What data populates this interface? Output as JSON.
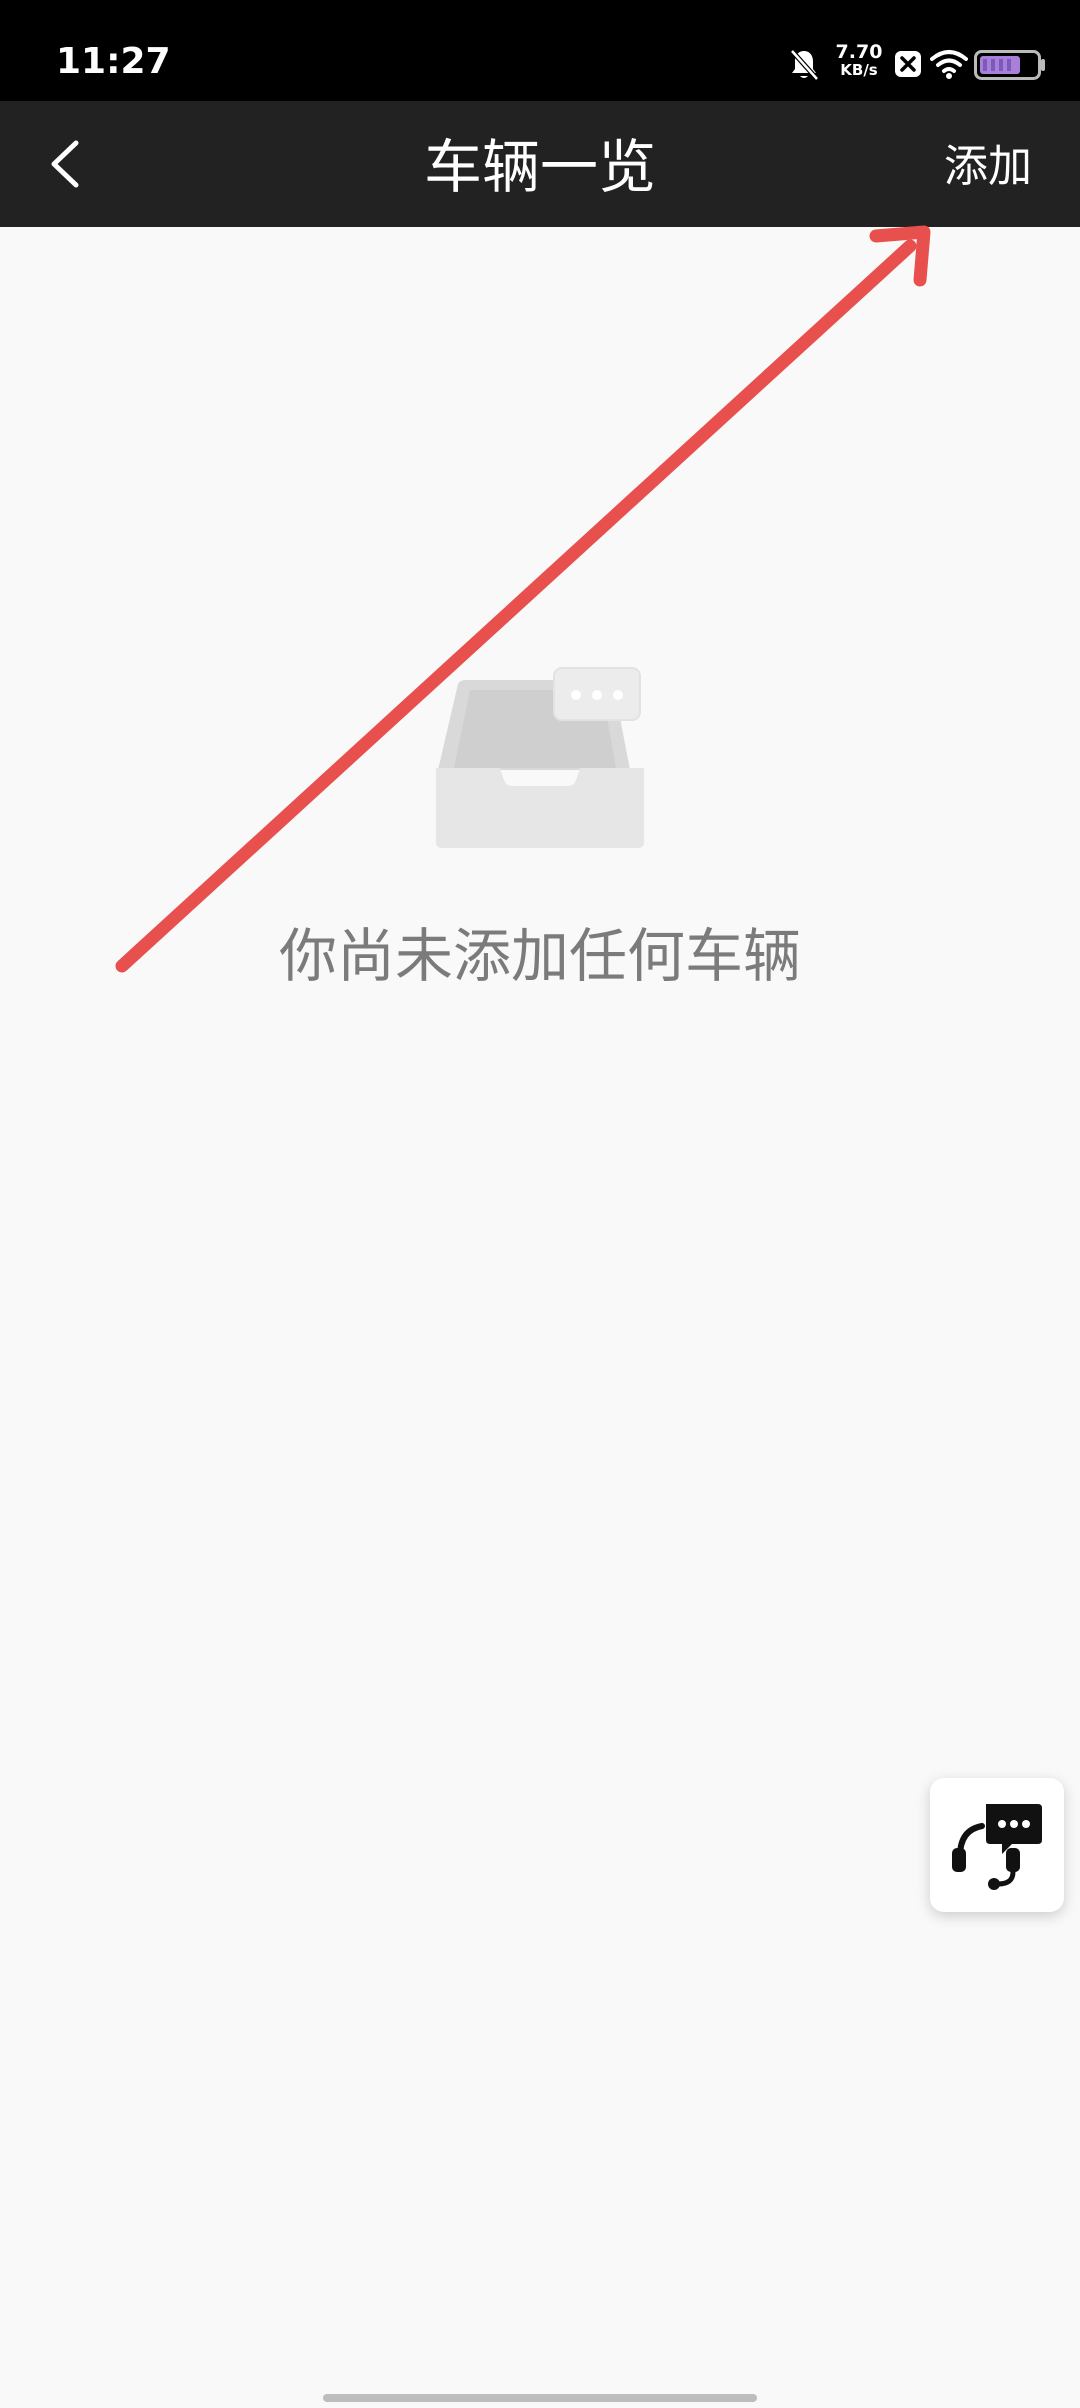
{
  "status_bar": {
    "time": "11:27",
    "net_speed_value": "7.70",
    "net_speed_unit": "KB/s",
    "icons": [
      "bell-muted-icon",
      "app-notification-icon",
      "wifi-icon",
      "battery-icon"
    ]
  },
  "header": {
    "back_icon": "chevron-left-icon",
    "title": "车辆一览",
    "add_label": "添加"
  },
  "empty_state": {
    "illustration": "empty-inbox-tray-icon",
    "message": "你尚未添加任何车辆"
  },
  "support_button": {
    "icon": "customer-support-headset-icon"
  },
  "annotation": {
    "type": "arrow",
    "color": "#e8504e"
  },
  "colors": {
    "app_bar": "#222222",
    "background": "#f9f9f9",
    "empty_text": "#7b7b7b"
  }
}
